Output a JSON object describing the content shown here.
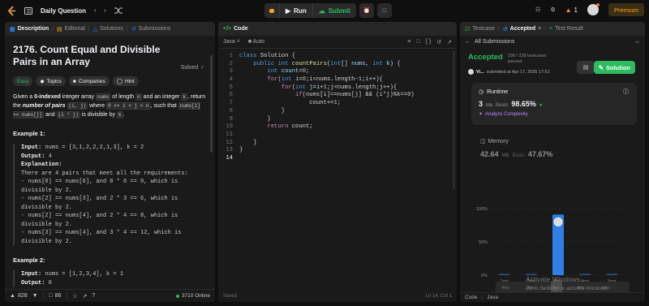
{
  "topbar": {
    "title": "Daily Question",
    "run_label": "Run",
    "submit_label": "Submit",
    "streak": "1",
    "premium_label": "Premium"
  },
  "left_panel": {
    "tabs": [
      "Description",
      "Editorial",
      "Solutions",
      "Submissions"
    ],
    "title": "2176. Count Equal and Divisible Pairs in an Array",
    "solved_label": "Solved",
    "tags": [
      "Easy",
      "Topics",
      "Companies",
      "Hint"
    ],
    "para": {
      "p1": "Given a ",
      "p2": "0-indexed",
      "p3": " integer array ",
      "c1": "nums",
      "p4": " of length ",
      "c2": "n",
      "p5": " and an integer ",
      "c3": "k",
      "p6": ", return the ",
      "p7": "number of pairs",
      "p8": " ",
      "c4": "(i, j)",
      "p9": " where ",
      "c5": "0 <= i < j < n",
      "p10": ", such that ",
      "c6": "nums[i] == nums[j]",
      "p11": " and ",
      "c7": "(i * j)",
      "p12": " is divisible by ",
      "c8": "k",
      "p13": "."
    },
    "example1_heading": "Example 1:",
    "example1": {
      "input_label": "Input:",
      "input": " nums = [3,1,2,2,2,1,3], k = 2",
      "output_label": "Output:",
      "output": " 4",
      "explanation_label": "Explanation:",
      "explanation_lines": [
        "There are 4 pairs that meet all the requirements:",
        "- nums[0] == nums[6], and 0 * 6 == 0, which is",
        "divisible by 2.",
        "- nums[2] == nums[3], and 2 * 3 == 6, which is",
        "divisible by 2.",
        "- nums[2] == nums[4], and 2 * 4 == 8, which is",
        "divisible by 2.",
        "- nums[3] == nums[4], and 3 * 4 == 12, which is",
        "divisible by 2."
      ]
    },
    "example2_heading": "Example 2:",
    "example2": {
      "input_label": "Input:",
      "input": " nums = [1,2,3,4], k = 1",
      "output_label": "Output:",
      "output": " 0"
    },
    "footer": {
      "likes": "828",
      "comments": "86",
      "online": "3710 Online"
    }
  },
  "editor": {
    "tab": "Code",
    "language": "Java",
    "mode": "Auto",
    "line_numbers": [
      "1",
      "2",
      "3",
      "4",
      "5",
      "6",
      "7",
      "8",
      "9",
      "10",
      "11",
      "12",
      "13",
      "14"
    ],
    "status_left": "Saved",
    "status_right": "Ln 14, Col 1"
  },
  "results": {
    "tabs": [
      "Testcase",
      "Accepted",
      "Test Result"
    ],
    "back_label": "All Submissions",
    "status": "Accepted",
    "testcases": "238 / 238 testcases",
    "testcases2": "passed",
    "user": "Vi...",
    "submitted": "submitted at Apr 17, 2025 17:51",
    "solution_label": "Solution",
    "runtime_label": "Runtime",
    "runtime_value": "3",
    "runtime_unit": "ms",
    "beats_label": "Beats",
    "runtime_beats": "98.65%",
    "analyze_label": "Analyze Complexity",
    "memory_label": "Memory",
    "memory_value": "42.64",
    "memory_unit": "MB",
    "memory_beats": "47.67%",
    "footer": [
      "Code",
      "Java"
    ]
  },
  "chart_data": {
    "type": "bar",
    "categories": [
      "1ms",
      "2ms",
      "3ms",
      "4ms",
      "5ms"
    ],
    "values": [
      2,
      2,
      91,
      2,
      2
    ],
    "highlight": "3ms",
    "y_ticks": [
      "100%",
      "50%",
      "0%"
    ],
    "ylim": [
      0,
      100
    ],
    "color": "#2f7fe6",
    "overview_labels": [
      "4ms",
      "2ms",
      "3ms",
      "4ms",
      "5ms"
    ]
  },
  "watermark": {
    "line1": "Activate Windows",
    "line2": "Go to Settings to activate Windows."
  }
}
